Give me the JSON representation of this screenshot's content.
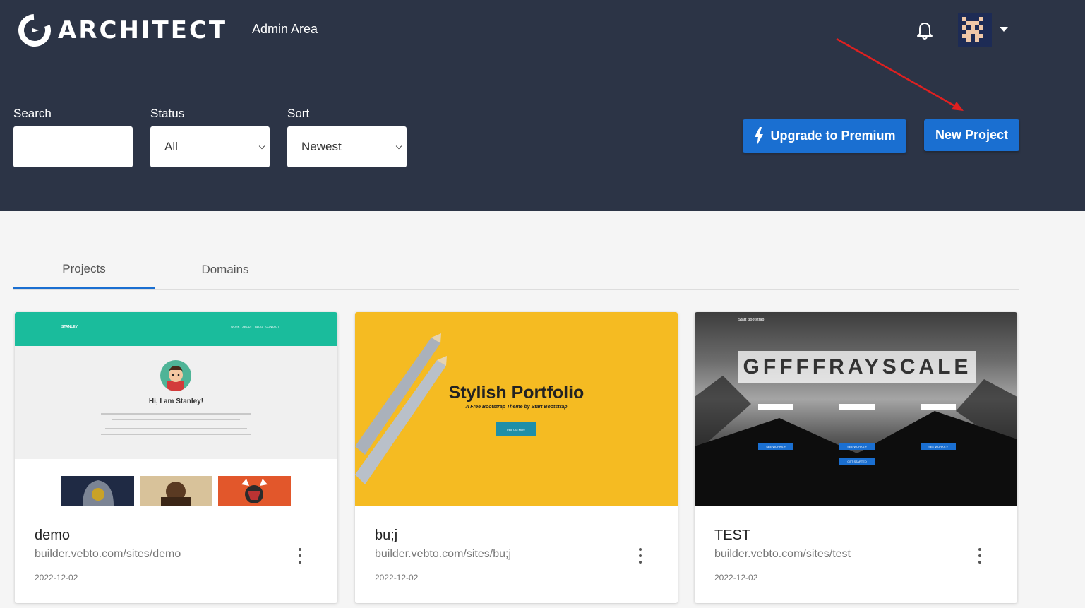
{
  "header": {
    "logo_text": "ARCHITECT",
    "admin_area": "Admin Area",
    "bg_color": "#2c3446"
  },
  "filters": {
    "search_label": "Search",
    "search_value": "",
    "status_label": "Status",
    "status_value": "All",
    "sort_label": "Sort",
    "sort_value": "Newest"
  },
  "actions": {
    "upgrade_label": "Upgrade to Premium",
    "new_project_label": "New Project",
    "accent_color": "#1a6fd1"
  },
  "tabs": [
    {
      "label": "Projects",
      "active": true
    },
    {
      "label": "Domains",
      "active": false
    }
  ],
  "projects": [
    {
      "name": "demo",
      "url": "builder.vebto.com/sites/demo",
      "date": "2022-12-02",
      "thumb": {
        "brand": "STANLEY",
        "nav": "WORK   ABOUT   BLOG   CONTACT",
        "heading": "Hi, I am Stanley!"
      }
    },
    {
      "name": "bu;j",
      "url": "builder.vebto.com/sites/bu;j",
      "date": "2022-12-02",
      "thumb": {
        "heading": "Stylish Portfolio",
        "subheading": "A Free Bootstrap Theme by Start Bootstrap",
        "button": "Find Out More"
      }
    },
    {
      "name": "TEST",
      "url": "builder.vebto.com/sites/test",
      "date": "2022-12-02",
      "thumb": {
        "brand": "Start Bootstrap",
        "heading": "GFFFFRAYSCALE",
        "button": "SEE WORKS »",
        "cta": "GET STARTED"
      }
    }
  ]
}
